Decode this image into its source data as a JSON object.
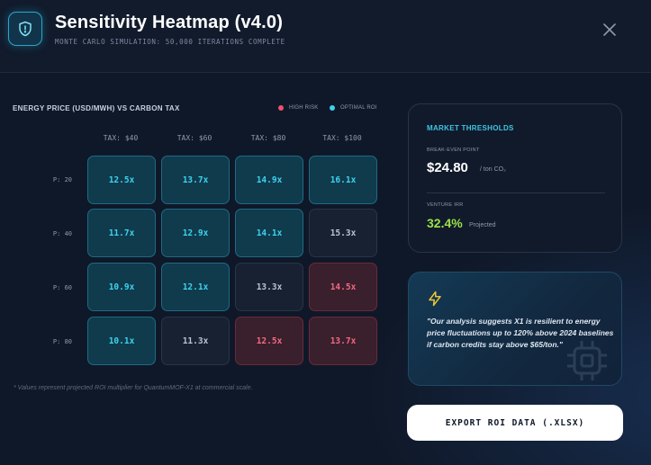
{
  "header": {
    "title": "Sensitivity Heatmap (v4.0)",
    "subtitle": "MONTE CARLO SIMULATION: 50,000 ITERATIONS COMPLETE"
  },
  "heatmap": {
    "title": "ENERGY PRICE (USD/MWH) VS CARBON TAX",
    "legend": [
      {
        "label": "HIGH RISK",
        "color": "#f0506e"
      },
      {
        "label": "OPTIMAL ROI",
        "color": "#3fd2ec"
      }
    ],
    "columns": [
      "TAX: $40",
      "TAX: $60",
      "TAX: $80",
      "TAX: $100"
    ],
    "rows": [
      {
        "label": "P: 20",
        "cells": [
          {
            "value": "12.5x",
            "status": "optimal"
          },
          {
            "value": "13.7x",
            "status": "optimal"
          },
          {
            "value": "14.9x",
            "status": "optimal"
          },
          {
            "value": "16.1x",
            "status": "optimal"
          }
        ]
      },
      {
        "label": "P: 40",
        "cells": [
          {
            "value": "11.7x",
            "status": "optimal"
          },
          {
            "value": "12.9x",
            "status": "optimal"
          },
          {
            "value": "14.1x",
            "status": "optimal"
          },
          {
            "value": "15.3x",
            "status": "neutral"
          }
        ]
      },
      {
        "label": "P: 60",
        "cells": [
          {
            "value": "10.9x",
            "status": "optimal"
          },
          {
            "value": "12.1x",
            "status": "optimal"
          },
          {
            "value": "13.3x",
            "status": "neutral"
          },
          {
            "value": "14.5x",
            "status": "risk"
          }
        ]
      },
      {
        "label": "P: 80",
        "cells": [
          {
            "value": "10.1x",
            "status": "optimal"
          },
          {
            "value": "11.3x",
            "status": "neutral"
          },
          {
            "value": "12.5x",
            "status": "risk"
          },
          {
            "value": "13.7x",
            "status": "risk"
          }
        ]
      }
    ],
    "footnote": "* Values represent projected ROI multiplier for QuantumMOF-X1 at commercial scale."
  },
  "thresholds": {
    "title": "MARKET THRESHOLDS",
    "break_even_label": "BREAK-EVEN POINT",
    "break_even_value": "$24.80",
    "break_even_unit": "/ ton CO₂",
    "irr_label": "VENTURE IRR",
    "irr_value": "32.4%",
    "irr_unit": "Projected"
  },
  "insight": {
    "icon": "lightning-icon",
    "text": "\"Our analysis suggests X1 is resilient to energy price fluctuations up to 120% above 2024 baselines if carbon credits stay above $65/ton.\""
  },
  "export_label": "EXPORT ROI DATA (.XLSX)",
  "colors": {
    "accent": "#3fd2ec",
    "risk": "#f0506e",
    "positive": "#9be04a"
  }
}
